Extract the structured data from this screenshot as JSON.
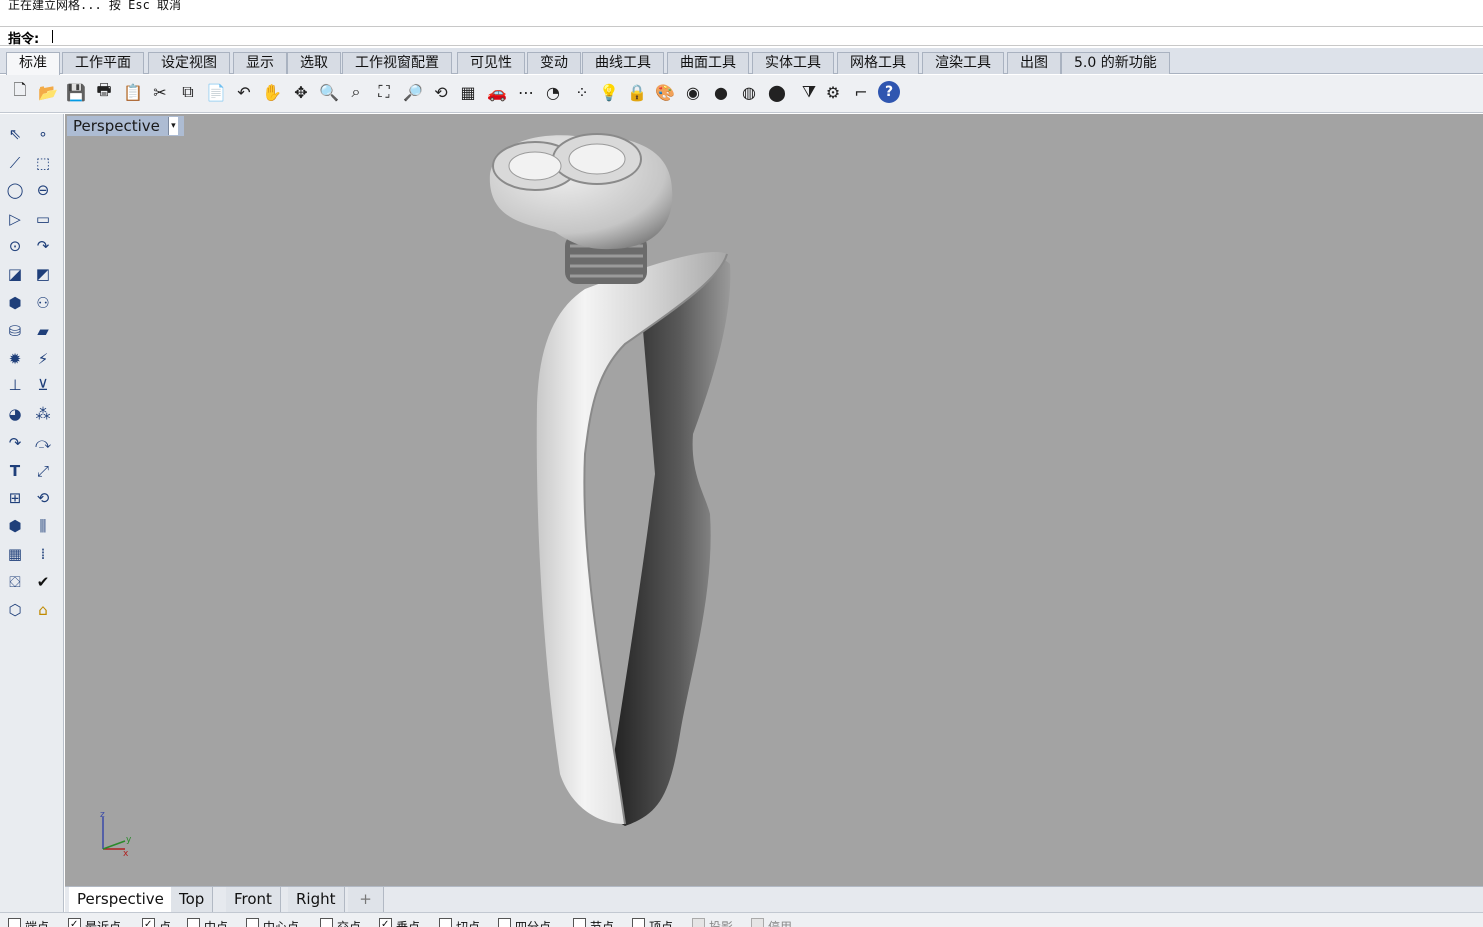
{
  "command": {
    "history": "正在建立网格... 按 Esc 取消",
    "prompt": "指令:"
  },
  "toolbar_tabs": [
    "标准",
    "工作平面",
    "设定视图",
    "显示",
    "选取",
    "工作视窗配置",
    "可见性",
    "变动",
    "曲线工具",
    "曲面工具",
    "实体工具",
    "网格工具",
    "渲染工具",
    "出图",
    "5.0 的新功能"
  ],
  "toolbar_icons": {
    "new": "🗋",
    "open": "📂",
    "save": "💾",
    "print": "🖶",
    "paste_special": "📋",
    "cut": "✂",
    "copy": "⧉",
    "paste": "📄",
    "undo": "↶",
    "pan": "✋",
    "rotate": "✥",
    "zoom_dynamic": "🔍",
    "zoom_window": "⌕",
    "zoom_extents": "⛶",
    "zoom_selected": "🔎",
    "rotate_view": "⟲",
    "four_views": "▦",
    "car": "🚗",
    "grid": "⋯",
    "circle_tool": "◔",
    "snap_points": "⁘",
    "light": "💡",
    "lock": "🔒",
    "material": "🎨",
    "color_wheel": "◉",
    "sphere_gray": "●",
    "sphere_light": "◍",
    "sphere_blue": "⬤",
    "filter": "⧩",
    "gear": "⚙",
    "osnap_tool": "⌐",
    "help": "?"
  },
  "side_icons": [
    "⇖",
    "∘",
    "⟋",
    "⬚",
    "◯",
    "⊖",
    "▷",
    "▭",
    "⊙",
    "↷",
    "◪",
    "◩",
    "⬢",
    "⚇",
    "⛁",
    "▰",
    "✹",
    "⚡",
    "⊥",
    "⊻",
    "◕",
    "⁂",
    "↷",
    "⤼",
    "T",
    "⤢",
    "⊞",
    "⟲",
    "⬢",
    "⫼",
    "▦",
    "⁞",
    "⛋",
    "✔",
    "⬡",
    "⌂"
  ],
  "viewport": {
    "title": "Perspective",
    "axis": {
      "z": "z",
      "y": "y",
      "x": "x"
    }
  },
  "viewport_tabs": [
    "Perspective",
    "Top",
    "Front",
    "Right",
    "+"
  ],
  "osnaps": [
    {
      "label": "端点",
      "checked": false
    },
    {
      "label": "最近点",
      "checked": true
    },
    {
      "label": "点",
      "checked": true
    },
    {
      "label": "中点",
      "checked": false
    },
    {
      "label": "中心点",
      "checked": false
    },
    {
      "label": "交点",
      "checked": false
    },
    {
      "label": "垂点",
      "checked": true
    },
    {
      "label": "切点",
      "checked": false
    },
    {
      "label": "四分点",
      "checked": false
    },
    {
      "label": "节点",
      "checked": false
    },
    {
      "label": "顶点",
      "checked": false
    },
    {
      "label": "投影",
      "checked": false,
      "disabled": true
    },
    {
      "label": "停用",
      "checked": false,
      "disabled": true
    }
  ]
}
